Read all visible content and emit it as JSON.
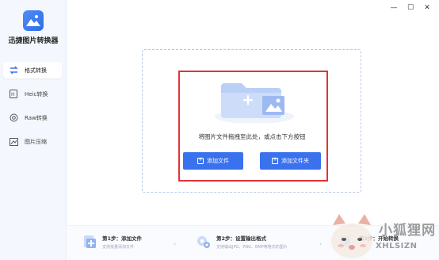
{
  "app": {
    "title": "迅捷图片转换器"
  },
  "window": {
    "minimize": "—",
    "maximize": "☐",
    "close": "✕"
  },
  "sidebar": {
    "items": [
      {
        "label": "格式转换",
        "icon": "format-convert-icon",
        "active": true
      },
      {
        "label": "Heic转换",
        "icon": "heic-icon",
        "active": false
      },
      {
        "label": "Raw转换",
        "icon": "raw-icon",
        "active": false
      },
      {
        "label": "图片压缩",
        "icon": "image-compress-icon",
        "active": false
      }
    ]
  },
  "main": {
    "prompt": "将图片文件拖拽至此处，或点击下方按钮",
    "add_file_label": "添加文件",
    "add_folder_label": "添加文件夹"
  },
  "steps": [
    {
      "title": "第1步：添加文件",
      "desc": "支持批量添加文件"
    },
    {
      "title": "第2步：设置输出格式",
      "desc": "支持输出JPG、PNG、BMP等格式的图片"
    },
    {
      "title": "第3步：开始转换",
      "desc": ""
    }
  ],
  "watermark": {
    "text": "小狐狸网",
    "sub": "XHLSIZN"
  },
  "colors": {
    "accent": "#3a72ee",
    "highlight": "#e0333a",
    "sidebar_bg": "#f4f7fd"
  }
}
